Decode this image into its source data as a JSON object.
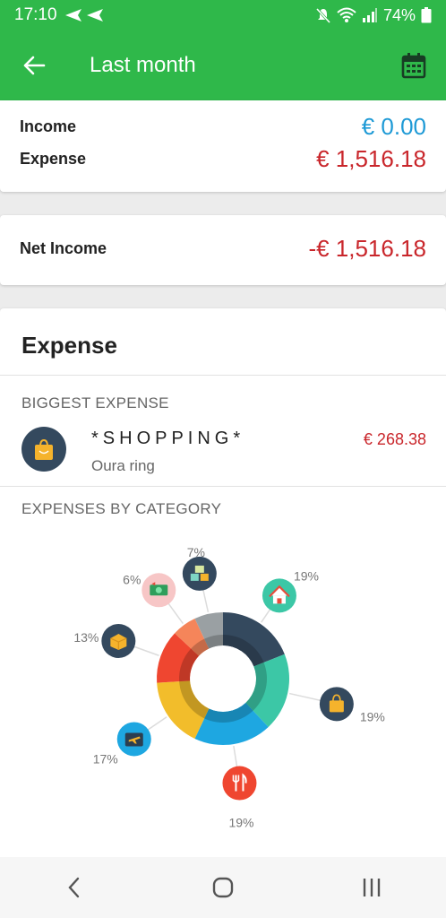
{
  "status_bar": {
    "time": "17:10",
    "battery": "74%"
  },
  "app_bar": {
    "title": "Last month"
  },
  "summary": {
    "income_label": "Income",
    "income_value": "€ 0.00",
    "expense_label": "Expense",
    "expense_value": "€ 1,516.18"
  },
  "net": {
    "label": "Net Income",
    "value": "-€ 1,516.18"
  },
  "expense_section": {
    "title": "Expense",
    "biggest_header": "BIGGEST EXPENSE",
    "biggest": {
      "category": "*SHOPPING*",
      "note": "Oura ring",
      "amount": "€ 268.38"
    },
    "by_category_header": "EXPENSES BY CATEGORY"
  },
  "chart_data": {
    "type": "pie",
    "donut": true,
    "slices": [
      {
        "icon": "home-icon",
        "percent": 19,
        "label": "19%",
        "color": "#34495e"
      },
      {
        "icon": "shopping-bag-icon",
        "percent": 19,
        "label": "19%",
        "color": "#3cc7a6"
      },
      {
        "icon": "restaurant-icon",
        "percent": 19,
        "label": "19%",
        "color": "#1ea7e1"
      },
      {
        "icon": "airplane-icon",
        "percent": 17,
        "label": "17%",
        "color": "#f2bd2b"
      },
      {
        "icon": "package-icon",
        "percent": 13,
        "label": "13%",
        "color": "#ef4630"
      },
      {
        "icon": "money-icon",
        "percent": 6,
        "label": "6%",
        "color": "#f5855a"
      },
      {
        "icon": "boxes-icon",
        "percent": 7,
        "label": "7%",
        "color": "#9aa0a3"
      }
    ]
  }
}
